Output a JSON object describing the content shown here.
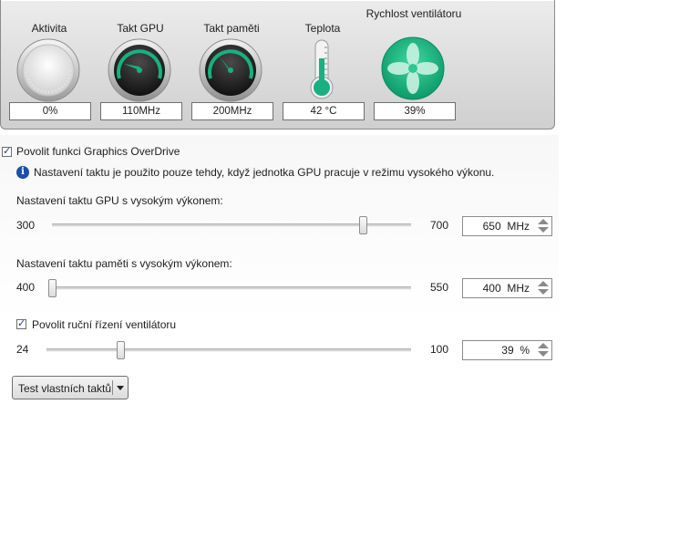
{
  "gauges": {
    "activity": {
      "title": "Aktivita",
      "value": "0%",
      "icon": "dial-gauge-icon",
      "level": 0
    },
    "gpu_clock": {
      "title": "Takt GPU",
      "value": "110MHz",
      "icon": "speedometer-icon"
    },
    "mem_clock": {
      "title": "Takt paměti",
      "value": "200MHz",
      "icon": "speedometer-icon"
    },
    "temperature": {
      "title": "Teplota",
      "value": "42  °C",
      "icon": "thermometer-icon"
    },
    "fan_speed": {
      "title": "Rychlost ventilátoru",
      "value": "39%",
      "icon": "fan-icon"
    }
  },
  "overdrive": {
    "enable_label": "Povolit funkci Graphics OverDrive",
    "enabled": true,
    "info_icon": "info-icon",
    "info_text": "Nastavení taktu je použito pouze tehdy, když jednotka GPU pracuje v režimu vysokého výkonu.",
    "gpu": {
      "label": "Nastavení taktu GPU s vysokým výkonem:",
      "min": "300",
      "max": "700",
      "value": "650",
      "unit": "MHz",
      "fraction": 0.875
    },
    "memory": {
      "label": "Nastavení taktu paměti s vysokým výkonem:",
      "min": "400",
      "max": "550",
      "value": "400",
      "unit": "MHz",
      "fraction": 0
    },
    "fan": {
      "enable_label": "Povolit ruční řízení ventilátoru",
      "enabled": true,
      "min": "24",
      "max": "100",
      "value": "39",
      "unit": "%",
      "fraction": 0.197
    }
  },
  "test_button": {
    "label": "Test vlastních taktů",
    "icon": "dropdown-arrow-icon"
  },
  "colors": {
    "accent_green": "#19b07f",
    "panel_bg": "#d9d9d9",
    "info_blue": "#1b4fa8"
  }
}
